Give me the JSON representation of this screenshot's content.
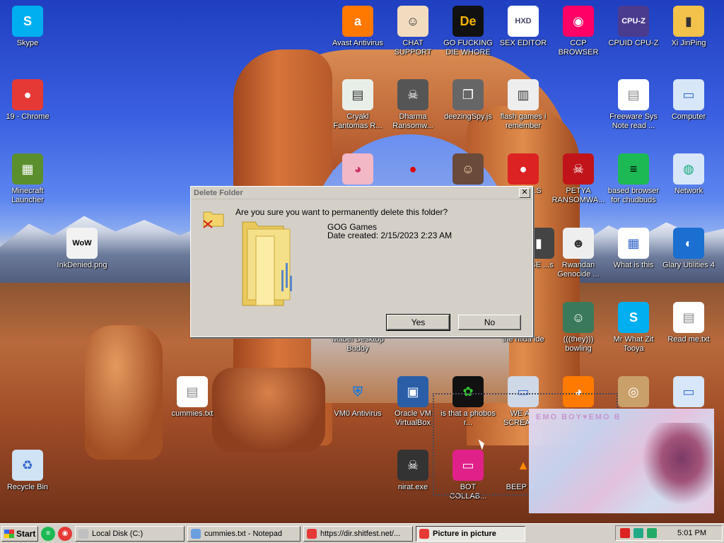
{
  "desktop": {
    "icons": [
      {
        "id": "skype",
        "label": "Skype",
        "glyph": "S",
        "bg": "#00aff0",
        "color": "#fff"
      },
      {
        "id": "chrome",
        "label": "19 - Chrome",
        "glyph": "●",
        "bg": "#e53935",
        "color": "#fff"
      },
      {
        "id": "minecraft",
        "label": "Minecraft Launcher",
        "glyph": "▦",
        "bg": "#5b8f2e",
        "color": "#fff"
      },
      {
        "id": "inkdenied",
        "label": "InkDenied.png",
        "glyph": "WoW",
        "bg": "#f2f2f2",
        "color": "#000"
      },
      {
        "id": "recycle",
        "label": "Recycle Bin",
        "glyph": "♻",
        "bg": "#cfe3f4",
        "color": "#36c"
      },
      {
        "id": "avast",
        "label": "Avast Antivirus",
        "glyph": "a",
        "bg": "#ff7800",
        "color": "#fff"
      },
      {
        "id": "chat",
        "label": "CHAT SUPPORT",
        "glyph": "☺",
        "bg": "#f2dcbf",
        "color": "#333"
      },
      {
        "id": "gofucking",
        "label": "GO FUCKING DIE WHORE",
        "glyph": "De",
        "bg": "#111",
        "color": "#f4b400"
      },
      {
        "id": "sexeditor",
        "label": "SEX EDITOR",
        "glyph": "HXD",
        "bg": "#fff",
        "color": "#446"
      },
      {
        "id": "ccp",
        "label": "CCP BROWSER",
        "glyph": "◉",
        "bg": "#f06",
        "color": "#fff"
      },
      {
        "id": "cpuz",
        "label": "CPUID CPU-Z",
        "glyph": "CPU-Z",
        "bg": "#4b3b8f",
        "color": "#fff"
      },
      {
        "id": "xi",
        "label": "Xi JinPing",
        "glyph": "▮",
        "bg": "#f3c24a",
        "color": "#333"
      },
      {
        "id": "cryakl",
        "label": "Cryakl Fantomas R...",
        "glyph": "▤",
        "bg": "#e8efe8",
        "color": "#333"
      },
      {
        "id": "dharma",
        "label": "Dharma Ransomw...",
        "glyph": "☠",
        "bg": "#555",
        "color": "#fff"
      },
      {
        "id": "deezing",
        "label": "deezingSpy.js",
        "glyph": "❐",
        "bg": "#666",
        "color": "#fff"
      },
      {
        "id": "flash",
        "label": "flash games i remember",
        "glyph": "▥",
        "bg": "#eee",
        "color": "#333"
      },
      {
        "id": "freeware",
        "label": "Freeware Sys Note read ...",
        "glyph": "▤",
        "bg": "#fff",
        "color": "#888"
      },
      {
        "id": "computer",
        "label": "Computer",
        "glyph": "▭",
        "bg": "#d7e6f8",
        "color": "#36c"
      },
      {
        "id": "angry",
        "label": "BAD... ...S",
        "glyph": "●",
        "bg": "#d22",
        "color": "#fff"
      },
      {
        "id": "petya",
        "label": "PETYA RANSOMWA...",
        "glyph": "☠",
        "bg": "#c0141a",
        "color": "#fff"
      },
      {
        "id": "based",
        "label": "based browser for chudbuds",
        "glyph": "≡",
        "bg": "#1db954",
        "color": "#000"
      },
      {
        "id": "network",
        "label": "Network",
        "glyph": "◍",
        "bg": "#d7e6f8",
        "color": "#1a7"
      },
      {
        "id": "rwandan",
        "label": "Rwandan Genocide ...",
        "glyph": "☻",
        "bg": "#eee",
        "color": "#333"
      },
      {
        "id": "whatis",
        "label": "What is this",
        "glyph": "▦",
        "bg": "#fff",
        "color": "#36c"
      },
      {
        "id": "glary",
        "label": "Glary Utilities 4",
        "glyph": "◐",
        "bg": "#1a6fd1",
        "color": "#fff"
      },
      {
        "id": "se",
        "label": "...SE ...s",
        "glyph": "▮",
        "bg": "#444",
        "color": "#fff"
      },
      {
        "id": "mabel",
        "label": "Mabel Desktop Buddy",
        "glyph": "♥",
        "bg": "#f5c6d6",
        "color": "#c33"
      },
      {
        "id": "hilda",
        "label": "the hilda ide",
        "glyph": "",
        "bg": "transparent",
        "color": "#fff"
      },
      {
        "id": "bowling",
        "label": "(((they))) bowling",
        "glyph": "☺",
        "bg": "#3a7a5a",
        "color": "#fff"
      },
      {
        "id": "mrwhat",
        "label": "Mr What Zit Tooya",
        "glyph": "S",
        "bg": "#00aff0",
        "color": "#fff"
      },
      {
        "id": "readme",
        "label": "Read me.txt",
        "glyph": "▤",
        "bg": "#fff",
        "color": "#888"
      },
      {
        "id": "cummies",
        "label": "cummies.txt",
        "glyph": "▤",
        "bg": "#fff",
        "color": "#888"
      },
      {
        "id": "vm0",
        "label": "VM0 Antivirus",
        "glyph": "⛨",
        "bg": "transparent",
        "color": "#1e7bd7"
      },
      {
        "id": "oracle",
        "label": "Oracle VM VirtualBox",
        "glyph": "▣",
        "bg": "#2a5fa8",
        "color": "#fff"
      },
      {
        "id": "phobos",
        "label": "is that a phobos r...",
        "glyph": "✿",
        "bg": "#111",
        "color": "#3c3"
      },
      {
        "id": "wea",
        "label": "WE A... SCREAM...",
        "glyph": "▭",
        "bg": "#cfd8e6",
        "color": "#36c"
      },
      {
        "id": "firefox",
        "label": "",
        "glyph": "◕",
        "bg": "#ff7a00",
        "color": "#fff"
      },
      {
        "id": "cd",
        "label": "",
        "glyph": "◎",
        "bg": "#caa06a",
        "color": "#fff"
      },
      {
        "id": "netpc",
        "label": "",
        "glyph": "▭",
        "bg": "#d7e6f8",
        "color": "#36c"
      },
      {
        "id": "nirat",
        "label": "nirat.exe",
        "glyph": "☠",
        "bg": "#333",
        "color": "#fff"
      },
      {
        "id": "bot",
        "label": "BOT COLLAB...",
        "glyph": "▭",
        "bg": "#e0218a",
        "color": "#fff"
      },
      {
        "id": "beep",
        "label": "BEEP B...",
        "glyph": "▲",
        "bg": "transparent",
        "color": "#f80"
      },
      {
        "id": "apple",
        "label": "",
        "glyph": "●",
        "bg": "transparent",
        "color": "#d00"
      },
      {
        "id": "pig",
        "label": "",
        "glyph": "◕",
        "bg": "#f2b8c6",
        "color": "#c36"
      },
      {
        "id": "portrait",
        "label": "",
        "glyph": "☺",
        "bg": "#6a4a3a",
        "color": "#f2d2b0"
      }
    ]
  },
  "dialog": {
    "title": "Delete Folder",
    "close_label": "✕",
    "question": "Are you sure you want to permanently delete this folder?",
    "folder_name": "GOG Games",
    "folder_date": "Date created: 2/15/2023 2:23 AM",
    "yes_label": "Yes",
    "no_label": "No"
  },
  "pip": {
    "overlay_text": "EMO BOY♥EMO B"
  },
  "taskbar": {
    "start_label": "Start",
    "quicklaunch": [
      {
        "id": "spotify",
        "glyph": "≡",
        "bg": "#1db954"
      },
      {
        "id": "chrome",
        "glyph": "◉",
        "bg": "#e53935"
      }
    ],
    "tasks": [
      {
        "id": "local-disk",
        "label": "Local Disk (C:)",
        "active": false,
        "icon_color": "#c0c0c0",
        "width": 155
      },
      {
        "id": "notepad",
        "label": "cummies.txt - Notepad",
        "active": false,
        "icon_color": "#6aa0e0",
        "width": 160
      },
      {
        "id": "chrome-tab",
        "label": "https://dir.shitfest.net/...",
        "active": false,
        "icon_color": "#e53935",
        "width": 155
      },
      {
        "id": "pip-window",
        "label": "Picture in picture",
        "active": true,
        "icon_color": "#e53935",
        "width": 155
      }
    ],
    "tray": {
      "clock": "5:01 PM",
      "icons": [
        {
          "id": "flag",
          "color": "#d22"
        },
        {
          "id": "network",
          "color": "#2a8"
        },
        {
          "id": "volume",
          "color": "#2a6"
        }
      ]
    }
  }
}
